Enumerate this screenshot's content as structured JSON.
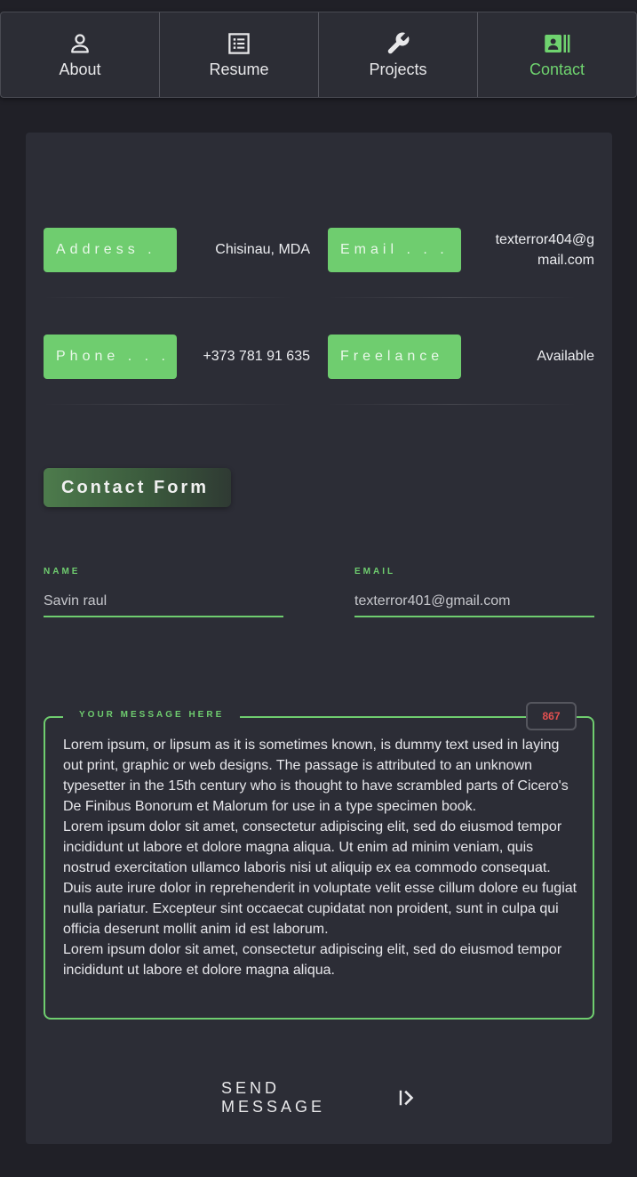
{
  "nav": {
    "items": [
      {
        "label": "About",
        "icon": "user-icon",
        "active": false
      },
      {
        "label": "Resume",
        "icon": "list-icon",
        "active": false
      },
      {
        "label": "Projects",
        "icon": "wrench-icon",
        "active": false
      },
      {
        "label": "Contact",
        "icon": "contact-card-icon",
        "active": true
      }
    ]
  },
  "info": {
    "address_label": "Address .",
    "address_value": "Chisinau, MDA",
    "email_label": "Email . . .",
    "email_value_line1": "texterror404@g",
    "email_value_line2": "mail.com",
    "phone_label": "Phone . . .",
    "phone_value": "+373 781 91 635",
    "freelance_label": "Freelance",
    "freelance_value": "Available"
  },
  "form": {
    "title": "Contact Form",
    "name_label": "NAME",
    "name_value": "Savin raul",
    "email_label": "EMAIL",
    "email_value": "texterror401@gmail.com",
    "message_label": "YOUR MESSAGE HERE",
    "char_count": "867",
    "message": "Lorem ipsum, or lipsum as it is sometimes known, is dummy text used in laying out print, graphic or web designs. The passage is attributed to an unknown typesetter in the 15th century who is thought to have scrambled parts of Cicero's De Finibus Bonorum et Malorum for use in a type specimen book.\nLorem ipsum dolor sit amet, consectetur adipiscing elit, sed do eiusmod tempor incididunt ut labore et dolore magna aliqua. Ut enim ad minim veniam, quis nostrud exercitation ullamco laboris nisi ut aliquip ex ea commodo consequat. Duis aute irure dolor in reprehenderit in voluptate velit esse cillum dolore eu fugiat nulla pariatur. Excepteur sint occaecat cupidatat non proident, sunt in culpa qui officia deserunt mollit anim id est laborum.\nLorem ipsum dolor sit amet, consectetur adipiscing elit, sed do eiusmod tempor incididunt ut labore et dolore magna aliqua.",
    "send_label": "SEND MESSAGE"
  },
  "colors": {
    "accent": "#6fcd6f",
    "background": "#202027",
    "panel": "#2c2d36",
    "counter": "#e35050"
  }
}
